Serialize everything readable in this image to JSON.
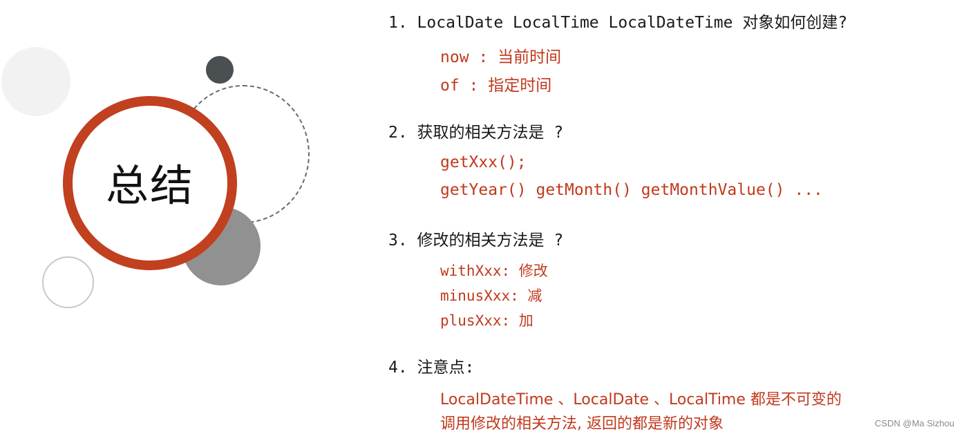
{
  "title": "总结",
  "colors": {
    "accent": "#c1401f",
    "answer_text": "#c0391c",
    "question_text": "#1a1a1a",
    "dark_circle": "#4a4f51",
    "mid_circle": "#919191",
    "light_circle": "#f2f2f2"
  },
  "sections": [
    {
      "question": "1. LocalDate LocalTime LocalDateTime 对象如何创建?",
      "answers": [
        "now : 当前时间",
        "of : 指定时间"
      ]
    },
    {
      "question": "2. 获取的相关方法是 ?",
      "answers": [
        "getXxx();",
        "getYear() getMonth() getMonthValue() ..."
      ]
    },
    {
      "question": "3. 修改的相关方法是 ?",
      "answers": [
        "withXxx: 修改",
        "minusXxx: 减",
        "plusXxx: 加"
      ]
    },
    {
      "question": "4. 注意点:",
      "answers": [
        "LocalDateTime 、LocalDate 、LocalTime 都是不可变的",
        "调用修改的相关方法, 返回的都是新的对象"
      ]
    }
  ],
  "watermark": "CSDN @Ma Sizhou"
}
